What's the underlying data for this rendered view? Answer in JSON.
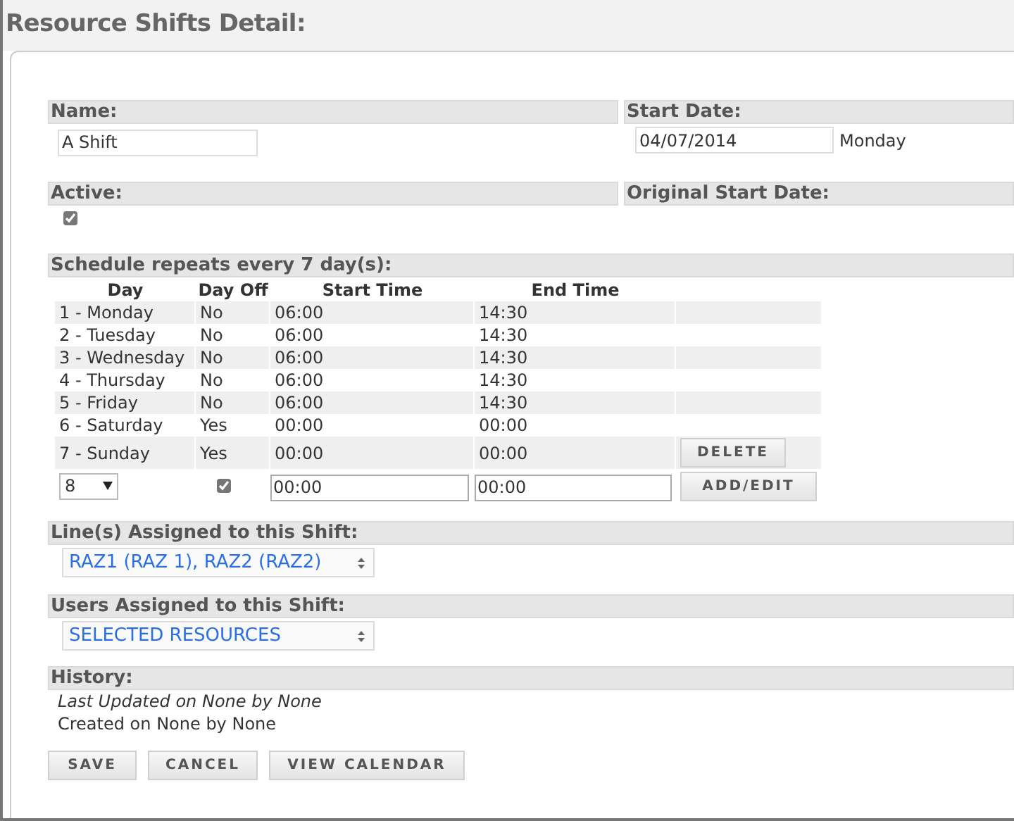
{
  "title": "Resource Shifts Detail:",
  "name": {
    "label": "Name:",
    "value": "A Shift"
  },
  "start_date": {
    "label": "Start Date:",
    "value": "04/07/2014",
    "weekday": "Monday"
  },
  "active": {
    "label": "Active:",
    "checked": true
  },
  "original_start_date": {
    "label": "Original Start Date:"
  },
  "schedule": {
    "title": "Schedule repeats every 7 day(s):",
    "columns": [
      "Day",
      "Day Off",
      "Start Time",
      "End Time"
    ],
    "rows": [
      {
        "day": "1 - Monday",
        "day_off": "No",
        "start": "06:00",
        "end": "14:30"
      },
      {
        "day": "2 - Tuesday",
        "day_off": "No",
        "start": "06:00",
        "end": "14:30"
      },
      {
        "day": "3 - Wednesday",
        "day_off": "No",
        "start": "06:00",
        "end": "14:30"
      },
      {
        "day": "4 - Thursday",
        "day_off": "No",
        "start": "06:00",
        "end": "14:30"
      },
      {
        "day": "5 - Friday",
        "day_off": "No",
        "start": "06:00",
        "end": "14:30"
      },
      {
        "day": "6 - Saturday",
        "day_off": "Yes",
        "start": "00:00",
        "end": "00:00"
      },
      {
        "day": "7 - Sunday",
        "day_off": "Yes",
        "start": "00:00",
        "end": "00:00",
        "action": "DELETE"
      }
    ],
    "new_row": {
      "day": "8",
      "day_off": true,
      "start": "00:00",
      "end": "00:00",
      "button": "ADD/EDIT"
    }
  },
  "lines": {
    "label": "Line(s) Assigned to this Shift:",
    "value": "RAZ1 (RAZ 1), RAZ2 (RAZ2)"
  },
  "users": {
    "label": "Users Assigned to this Shift:",
    "value": "SELECTED RESOURCES"
  },
  "history": {
    "label": "History:",
    "last_updated": "Last Updated on None by None",
    "created": "Created on None by None"
  },
  "buttons": [
    "SAVE",
    "CANCEL",
    "VIEW CALENDAR"
  ]
}
